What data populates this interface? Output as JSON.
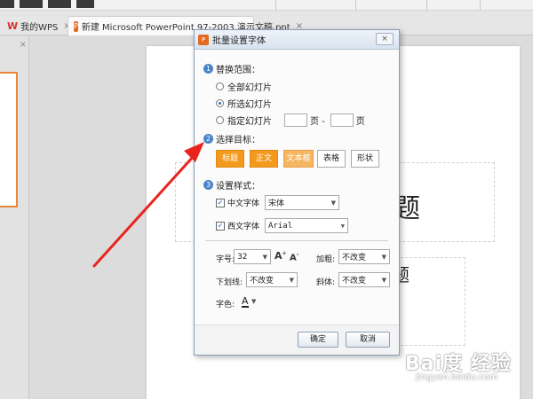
{
  "tabs": {
    "wps_label": "我的WPS",
    "wps_close": "×",
    "doc_label": "新建 Microsoft PowerPoint 97-2003 演示文稿.ppt",
    "doc_close": "×",
    "new_tab": "+"
  },
  "left_pane": {
    "close": "×"
  },
  "slide": {
    "title_visible": "题",
    "subtitle_visible": "题"
  },
  "dialog": {
    "title": "批量设置字体",
    "close": "×",
    "section1": {
      "number": "1",
      "label": "替换范围：",
      "options": [
        "全部幻灯片",
        "所选幻灯片",
        "指定幻灯片"
      ],
      "selected": "所选幻灯片",
      "page_label_1": "页 -",
      "page_label_2": "页"
    },
    "section2": {
      "number": "2",
      "label": "选择目标：",
      "buttons": [
        "标题",
        "正文",
        "文本框",
        "表格",
        "形状"
      ]
    },
    "section3": {
      "number": "3",
      "label": "设置样式：",
      "cn_font_label": "中文字体",
      "cn_font_value": "宋体",
      "en_font_label": "西文字体",
      "en_font_value": "Arial",
      "size_label": "字号:",
      "size_value": "32",
      "bold_label": "加粗:",
      "bold_value": "不改变",
      "underline_label": "下划线:",
      "underline_value": "不改变",
      "italic_label": "斜体:",
      "italic_value": "不改变",
      "color_label": "字色:",
      "color_glyph": "A"
    },
    "ok_label": "确定",
    "cancel_label": "取消"
  },
  "watermark": {
    "main": "Bai度 经验",
    "sub": "jingyan.baidu.com"
  },
  "colors": {
    "accent_orange": "#f39a1d",
    "arrow_red": "#e8241f",
    "step_blue": "#4a84c8"
  }
}
